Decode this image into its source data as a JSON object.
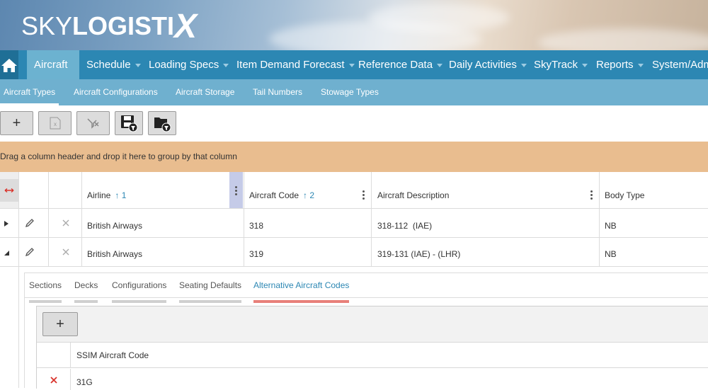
{
  "branding": {
    "logo_part1": "SKY",
    "logo_part2": "LOGISTI",
    "logo_part3": "X"
  },
  "main_nav": {
    "items": [
      {
        "label": "Aircraft",
        "active": true,
        "has_caret": false
      },
      {
        "label": "Schedule",
        "has_caret": true
      },
      {
        "label": "Loading Specs",
        "has_caret": true
      },
      {
        "label": "Item Demand Forecast",
        "has_caret": true
      },
      {
        "label": "Reference Data",
        "has_caret": true
      },
      {
        "label": "Daily Activities",
        "has_caret": true
      },
      {
        "label": "SkyTrack",
        "has_caret": true
      },
      {
        "label": "Reports",
        "has_caret": true
      },
      {
        "label": "System/Adm",
        "has_caret": false
      }
    ]
  },
  "sub_nav": {
    "items": [
      {
        "label": "Aircraft Types",
        "active": true
      },
      {
        "label": "Aircraft Configurations"
      },
      {
        "label": "Aircraft Storage"
      },
      {
        "label": "Tail Numbers"
      },
      {
        "label": "Stowage Types"
      }
    ]
  },
  "toolbar": {
    "add_label": "+",
    "icons": [
      "add-icon",
      "export-excel-icon",
      "clear-filter-icon",
      "save-filter-icon",
      "load-filter-icon"
    ]
  },
  "group_bar": {
    "text": "Drag a column header and drop it here to group by that column"
  },
  "grid": {
    "columns": [
      {
        "label": "Airline",
        "sort_order": "1"
      },
      {
        "label": "Aircraft Code",
        "sort_order": "2"
      },
      {
        "label": "Aircraft Description"
      },
      {
        "label": "Body Type"
      }
    ],
    "rows": [
      {
        "airline": "British Airways",
        "code": "318",
        "description": "318-112  (IAE)",
        "body": "NB",
        "expanded": false
      },
      {
        "airline": "British Airways",
        "code": "319",
        "description": "319-131 (IAE) - (LHR)",
        "body": "NB",
        "expanded": true
      }
    ]
  },
  "detail": {
    "tabs": [
      {
        "label": "Sections"
      },
      {
        "label": "Decks"
      },
      {
        "label": "Configurations"
      },
      {
        "label": "Seating Defaults"
      },
      {
        "label": "Alternative Aircraft Codes",
        "active": true
      }
    ],
    "add_label": "+",
    "column_header": "SSIM Aircraft Code",
    "rows": [
      {
        "code": "31G"
      }
    ]
  },
  "colors": {
    "nav": "#2c87b3",
    "nav_active": "#6cb2d0",
    "subnav": "#6fb0cf",
    "groupbar": "#e9bd8f",
    "delete_red": "#d9332b"
  }
}
